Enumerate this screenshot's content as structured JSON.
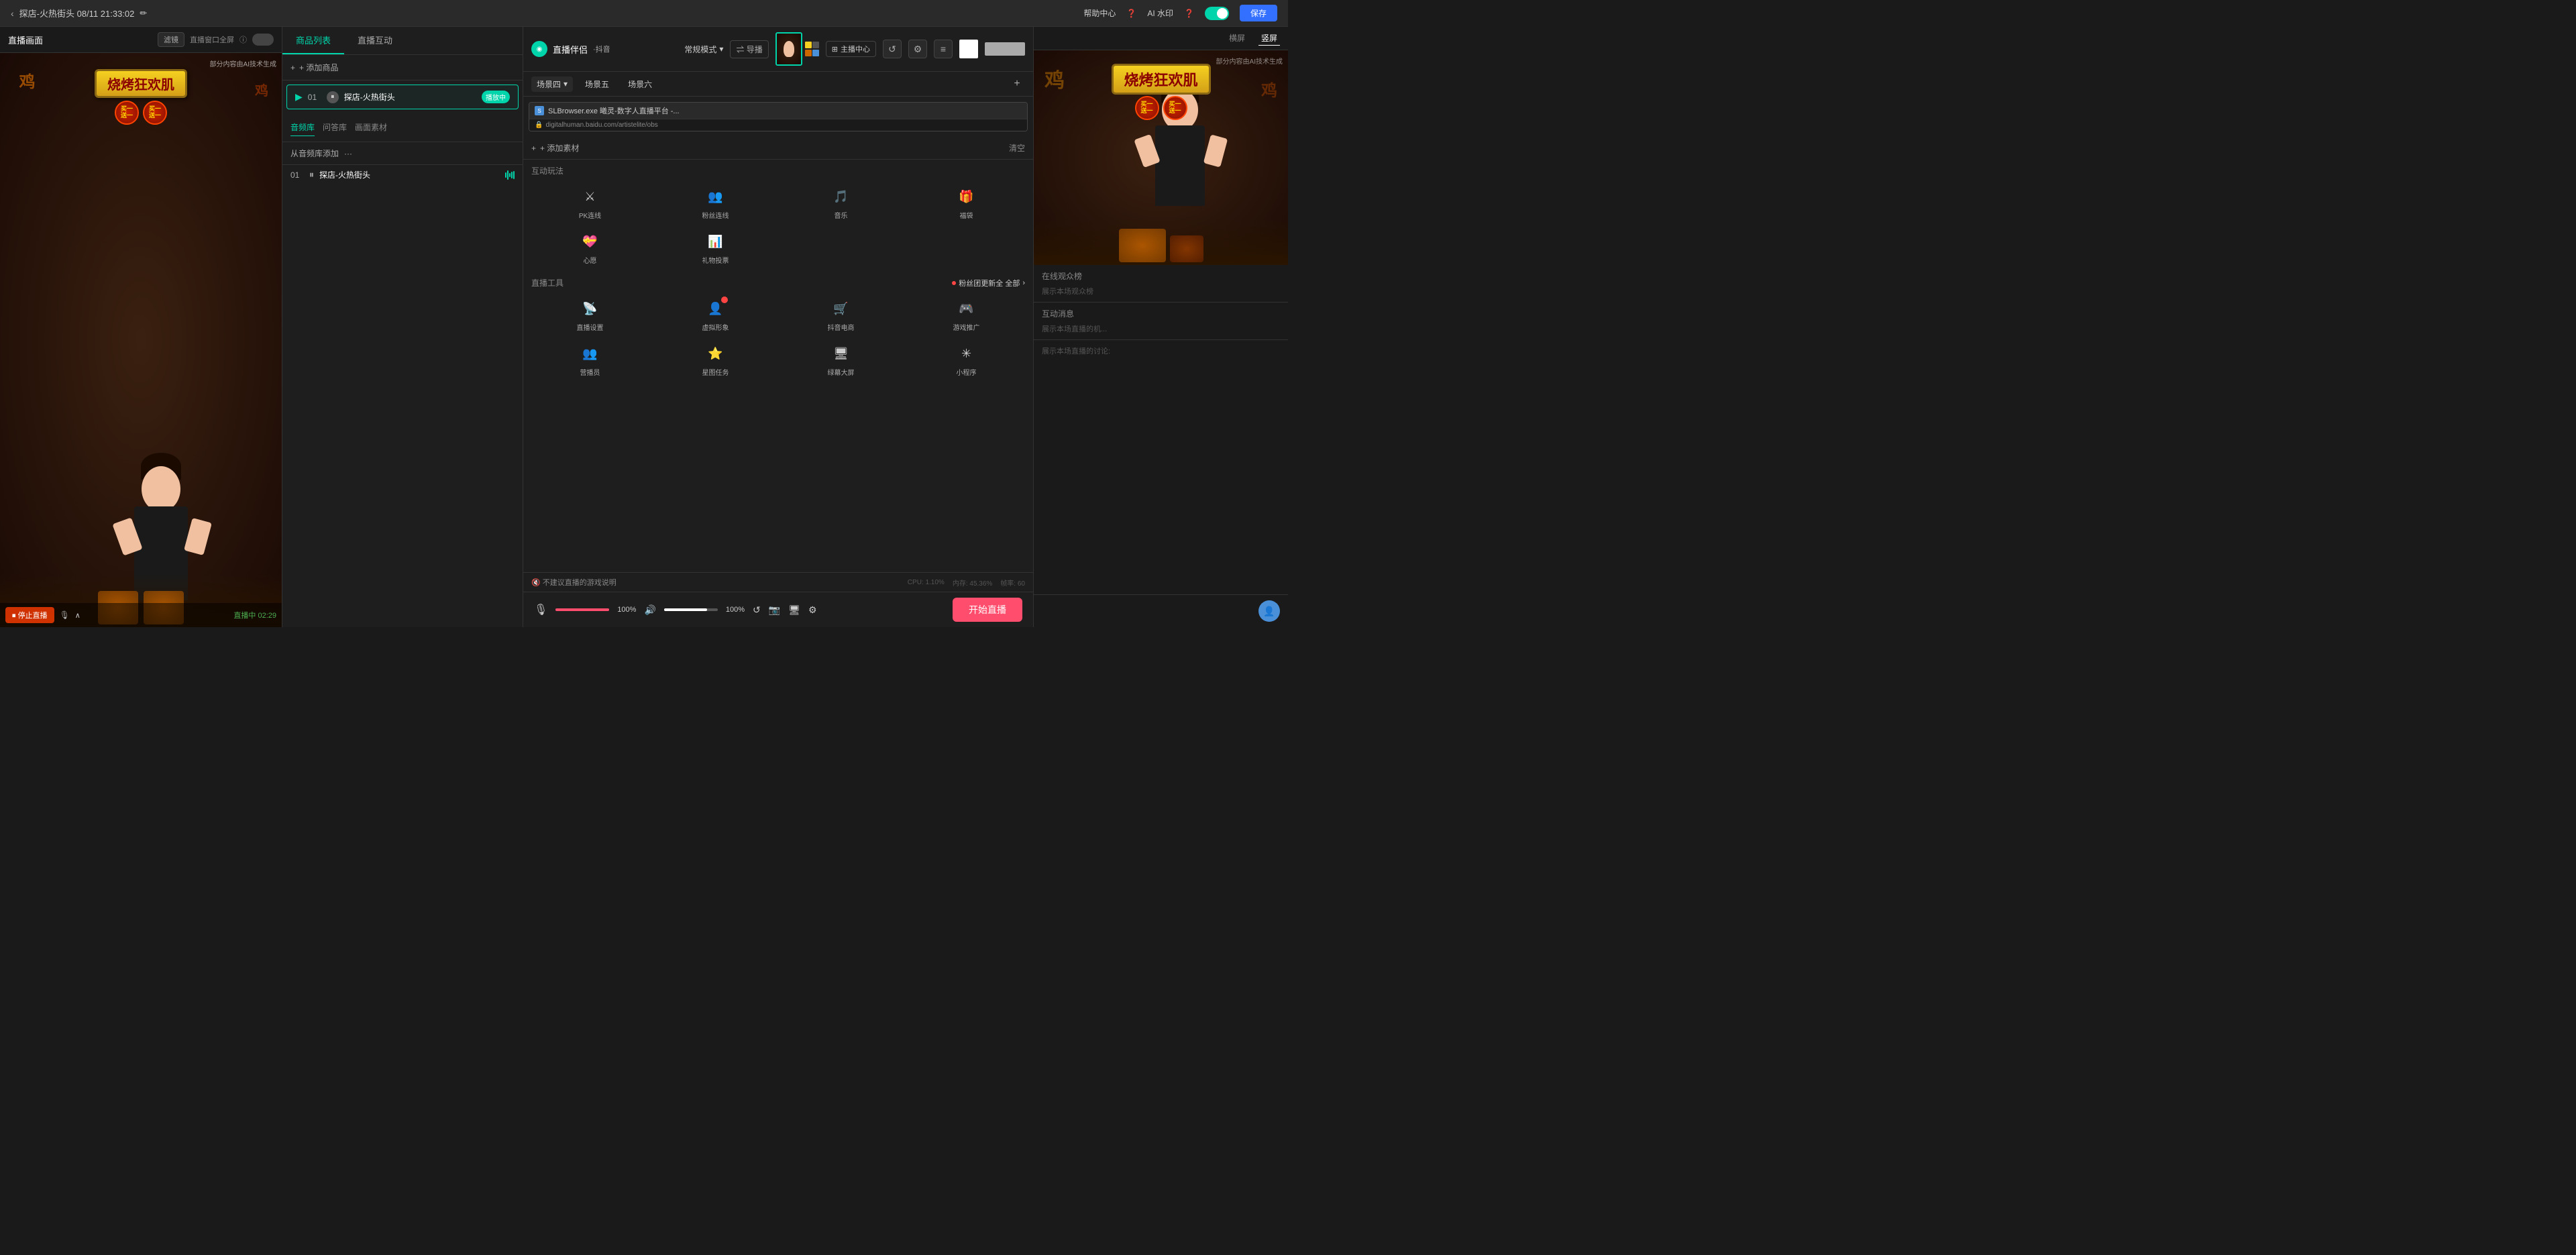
{
  "topbar": {
    "back_label": "探店-火热街头 08/11 21:33:02",
    "edit_icon": "✏",
    "help_label": "帮助中心",
    "ai_watermark_label": "AI 水印",
    "save_label": "保存"
  },
  "left_panel": {
    "title": "直播画面",
    "filter_label": "滤镜",
    "fullscreen_label": "直播窗口全屏",
    "ai_watermark": "部分内容由AI技术生成",
    "bbq_text": "烧烤狂欢肌",
    "buy_one_get_one": "买一送一",
    "stop_live_label": "停止直播",
    "live_duration": "直播中 02:29"
  },
  "browser_overlay": {
    "title": "曦灵-数字人直播平台 - 联想浏览器",
    "url": "digitalhuman.baidu.com/artistelite/obs"
  },
  "middle_panel": {
    "tab_product_list": "商品列表",
    "tab_live_interact": "直播互动",
    "add_product_label": "+ 添加商品",
    "product_item": {
      "num": "01",
      "name": "探店-火热街头",
      "playing_label": "播放中"
    },
    "audio_tabs": {
      "library_label": "音频库",
      "qa_label": "问答库",
      "canvas_label": "画面素材"
    },
    "from_library_label": "从音频库添加",
    "audio_item": {
      "num": "01",
      "name": "探店-火热街头"
    }
  },
  "companion_panel": {
    "title": "直播伴侣",
    "platform": "·抖音",
    "mode_label": "常规模式",
    "guide_export_label": "⇌ 导播",
    "scene_label": "场景四",
    "scenes": [
      "场景五",
      "场景六"
    ],
    "add_label": "+",
    "browser_title": "SLBrowser.exe 曦灵-数字人直播平台 -...",
    "add_material_label": "+ 添加素材",
    "clear_label": "清空",
    "interact_title": "互动玩法",
    "interact_items": [
      {
        "label": "PK连线",
        "icon": "⚔"
      },
      {
        "label": "粉丝连线",
        "icon": "👥"
      },
      {
        "label": "音乐",
        "icon": "🎵"
      },
      {
        "label": "福袋",
        "icon": "🎁"
      },
      {
        "label": "心愿",
        "icon": "💝"
      },
      {
        "label": "礼物投票",
        "icon": "📊"
      }
    ],
    "tools_title": "直播工具",
    "fans_update_label": "粉丝团更新全 全部",
    "tools": [
      {
        "label": "直播设置",
        "icon": "📡",
        "badge": false
      },
      {
        "label": "虚拟形象",
        "icon": "👤",
        "badge": true
      },
      {
        "label": "抖音电商",
        "icon": "🛒",
        "badge": false
      },
      {
        "label": "游戏推广",
        "icon": "🎮",
        "badge": false
      },
      {
        "label": "营播员",
        "icon": "👥",
        "badge": false
      },
      {
        "label": "星图任务",
        "icon": "⭐",
        "badge": false
      },
      {
        "label": "绿幕大屏",
        "icon": "🖥",
        "badge": false
      },
      {
        "label": "小程序",
        "icon": "✳",
        "badge": false
      }
    ]
  },
  "bottom_toolbar": {
    "mic_icon": "🎙",
    "volume_pct": "100%",
    "speaker_icon": "🔊",
    "volume_pct2": "100%",
    "start_live_label": "开始直播",
    "cpu_label": "CPU: 1.10%",
    "memory_label": "内存: 45.36%",
    "frame_label": "帧率: 60",
    "no_game_label": "不建议直播的游戏说明"
  },
  "right_panel": {
    "host_center_label": "主播中心",
    "tabs": {
      "horizontal_label": "横屏",
      "vertical_label": "竖屏"
    },
    "online_viewers_title": "在线观众榜",
    "show_local_viewers": "展示本场观众榜",
    "interact_msg_title": "互动消息",
    "show_local_broadcast": "展示本场直播的机...",
    "discuss_title": "展示本场直播的讨论:",
    "ai_watermark": "部分内容由AI技术生成",
    "preview_bbq_text": "烧烤狂欢肌"
  }
}
